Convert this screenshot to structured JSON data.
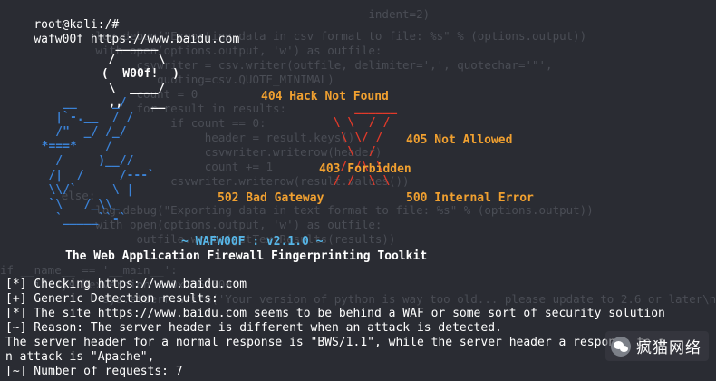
{
  "terminal": {
    "prompt": "root@kali:/#",
    "command": "wafw00f https://www.baidu.com"
  },
  "background_code": [
    "                                                      indent=2)",
    "              log.debug(\"Exporting data in csv format to file: %s\" % (options.output))",
    "              with open(options.output, 'w') as outfile:",
    "                    csvwriter = csv.writer(outfile, delimiter=',', quotechar='\"',",
    "                       quoting=csv.QUOTE_MINIMAL)",
    "                    count = 0",
    "                    for result in results:",
    "                         if count == 0:",
    "                              header = result.keys()",
    "                              csvwriter.writerow(header)",
    "                              count += 1",
    "                         csvwriter.writerow(result.values())",
    "         else:",
    "              log.debug(\"Exporting data in text format to file: %s\" % (options.output))",
    "              with open(options.output, 'w') as outfile:",
    "                    outfile.write(getTextResults(results))",
    "if __name__ == '__main__':",
    "     if sys.hexversion < 0x2060000:",
    "               sys.stderr.write('Your version of python is way too old... please update to 2.6 or later\\n')"
  ],
  "logo": {
    "woof_badge": "   ______\n  /      \\\n (  W00f!  )\n  \\  ____/\n  ,,    __",
    "dog": "     __     _/\n    |`-.__  / /\n    /\"  _/ /_/\n  *===*    /\n    /     )__//\n   /|  /     /---`\n   \\\\/`     \\ |\n   `\\   /_\\\\_\n    `_____``-`",
    "red_x": "     ______\n  \\ \\  / /\n   \\ \\/ /\n    \\  /\n   / /\\ \\\n  / /  \\ \\"
  },
  "errors": {
    "e404": "404 Hack Not Found",
    "e405": "405 Not Allowed",
    "e403": "403 Forbidden",
    "e502": "502 Bad Gateway",
    "e500": "500 Internal Error"
  },
  "banner": {
    "version": "~ WAFW00F : v2.1.0 ~",
    "tagline": "The Web Application Firewall Fingerprinting Toolkit"
  },
  "output": [
    "[*] Checking https://www.baidu.com",
    "[+] Generic Detection results:",
    "[*] The site https://www.baidu.com seems to be behind a WAF or some sort of security solution",
    "[~] Reason: The server header is different when an attack is detected.",
    "The server header for a normal response is \"BWS/1.1\", while the server header a response to a",
    "n attack is \"Apache\",",
    "[~] Number of requests: 7"
  ],
  "watermark": {
    "icon": "wechat-icon",
    "text": "疯猫网络"
  }
}
